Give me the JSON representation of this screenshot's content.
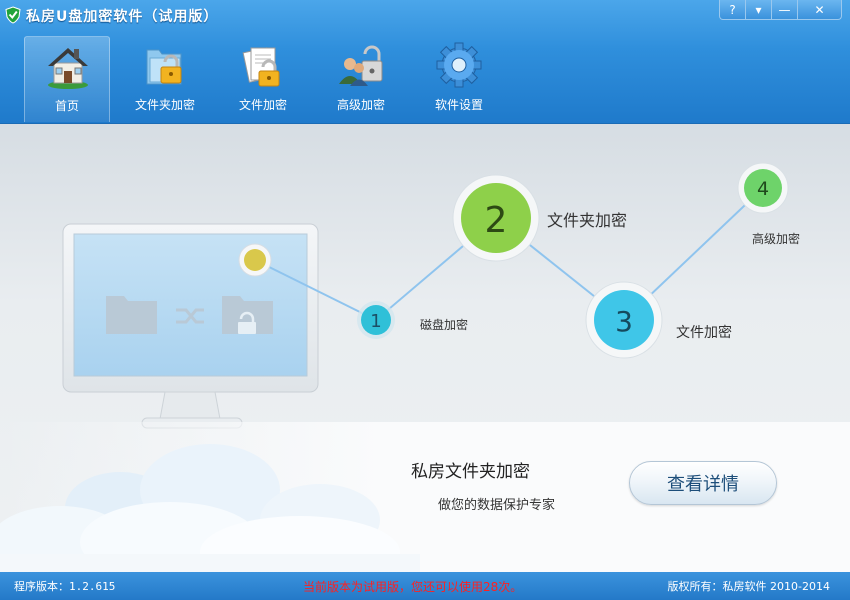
{
  "window": {
    "title": "私房U盘加密软件（试用版）",
    "controls": [
      "?",
      "▾",
      "—",
      "✕"
    ]
  },
  "toolbar": {
    "items": [
      {
        "label": "首页",
        "icon": "house-icon",
        "active": true
      },
      {
        "label": "文件夹加密",
        "icon": "locked-folder-icon",
        "active": false
      },
      {
        "label": "文件加密",
        "icon": "locked-document-icon",
        "active": false
      },
      {
        "label": "高级加密",
        "icon": "users-lock-icon",
        "active": false
      },
      {
        "label": "软件设置",
        "icon": "gear-icon",
        "active": false
      }
    ]
  },
  "steps": [
    {
      "number": "1",
      "label": "磁盘加密"
    },
    {
      "number": "2",
      "label": "文件夹加密"
    },
    {
      "number": "3",
      "label": "文件加密"
    },
    {
      "number": "4",
      "label": "高级加密"
    }
  ],
  "product": {
    "name": "私房文件夹加密",
    "slogan": "做您的数据保护专家",
    "detail_button": "查看详情"
  },
  "status": {
    "version": "程序版本：1.2.615",
    "trial_notice": "当前版本为试用版，您还可以使用28次。",
    "copyright": "版权所有：私房软件 2010-2014"
  },
  "colors": {
    "titlebar": "#2f8fdc",
    "step1": "#2fc0d8",
    "step2": "#8ed04a",
    "step3": "#3fc6e8",
    "step4": "#6ed36a",
    "trial_notice": "#ff2020"
  }
}
